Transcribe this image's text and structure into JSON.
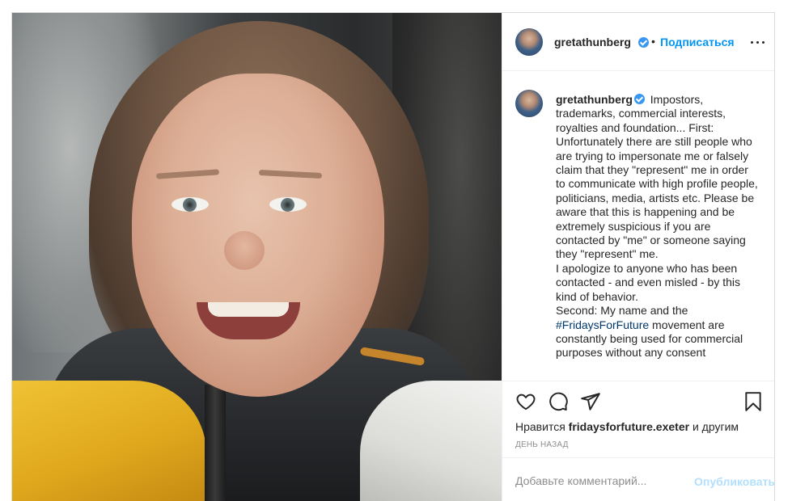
{
  "post": {
    "username": "gretathunberg",
    "follow_label": "Подписаться",
    "separator": "•",
    "caption": {
      "text_1": "Impostors, trademarks, commercial interests, royalties and foundation... First: Unfortunately there are still people who are trying to impersonate me or falsely claim that they \"represent\" me in order to communicate with high profile people, politicians, media, artists etc. Please be aware that this is happening and be extremely suspicious if you are contacted by \"me\" or someone saying they \"represent\" me.",
      "text_2": "I apologize to anyone who has been contacted - and even misled - by this kind of behavior.",
      "text_3": "Second: My name and the",
      "hashtag": "#FridaysForFuture",
      "text_4": "movement are constantly being used for commercial purposes without any consent"
    },
    "likes": {
      "prefix": "Нравится",
      "user": "fridaysforfuture.exeter",
      "suffix": "и другим"
    },
    "timestamp": "День назад",
    "comment": {
      "placeholder": "Добавьте комментарий...",
      "publish_label": "Опубликовать"
    }
  },
  "icons": {
    "like": "heart-icon",
    "comment": "comment-bubble-icon",
    "share": "paper-plane-icon",
    "save": "bookmark-icon",
    "more": "more-options-icon",
    "verified": "verified-badge-icon"
  },
  "colors": {
    "accent": "#0095f6",
    "verified": "#3897f0",
    "hashtag": "#00376b",
    "muted": "#8e8e8e",
    "publish_disabled": "#b2dffc"
  }
}
